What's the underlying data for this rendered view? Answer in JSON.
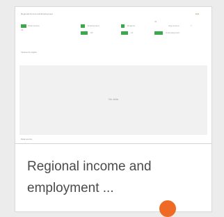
{
  "card": {
    "title": "Regional income and employment ...",
    "thumbnail": {
      "sheet_title": "Regional Income and Employment",
      "sheet_link": "Edit",
      "kpis": [
        {
          "label": "Total income",
          "value": "42"
        },
        {
          "label": "Employment",
          "value": "18"
        },
        {
          "label": "Regions",
          "value": "12"
        },
        {
          "label": "Avg income",
          "value": "34"
        },
        {
          "label": "Unemployment",
          "value": "7"
        }
      ],
      "section_label": "Income by region",
      "placeholder_text": "No data",
      "footer_text": "Data source"
    },
    "badge_color": "#ef6b25"
  }
}
